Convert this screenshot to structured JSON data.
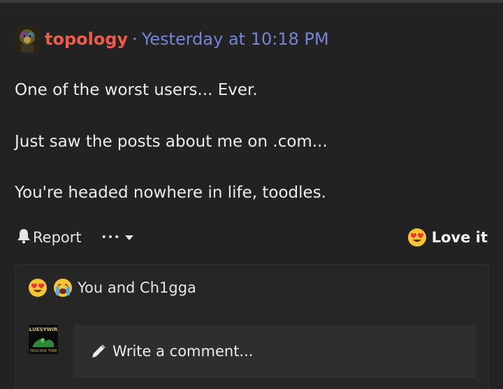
{
  "post": {
    "username": "topology",
    "separator": "·",
    "timestamp": "Yesterday at 10:18 PM",
    "lines": [
      "One of the worst users... Ever.",
      "Just saw the posts about me on .com...",
      "You're headed nowhere in life, toodles."
    ]
  },
  "actions": {
    "report_label": "Report",
    "more_label": "•••",
    "reaction_label": "Love it",
    "reaction_icon": "heart-eyes-emoji"
  },
  "reactions": {
    "icons": [
      "heart-eyes-emoji",
      "crying-emoji"
    ],
    "summary": "You and Ch1gga"
  },
  "comment": {
    "placeholder": "Write a comment...",
    "icon": "pencil-icon"
  },
  "avatar_small": {
    "text_top": "BLUESYWIRE",
    "text_bottom": "TRUCKIN TIME"
  },
  "colors": {
    "background": "#222222",
    "username": "#f05a48",
    "timestamp": "#7484d8",
    "emoji_yellow": "#f7c531"
  }
}
